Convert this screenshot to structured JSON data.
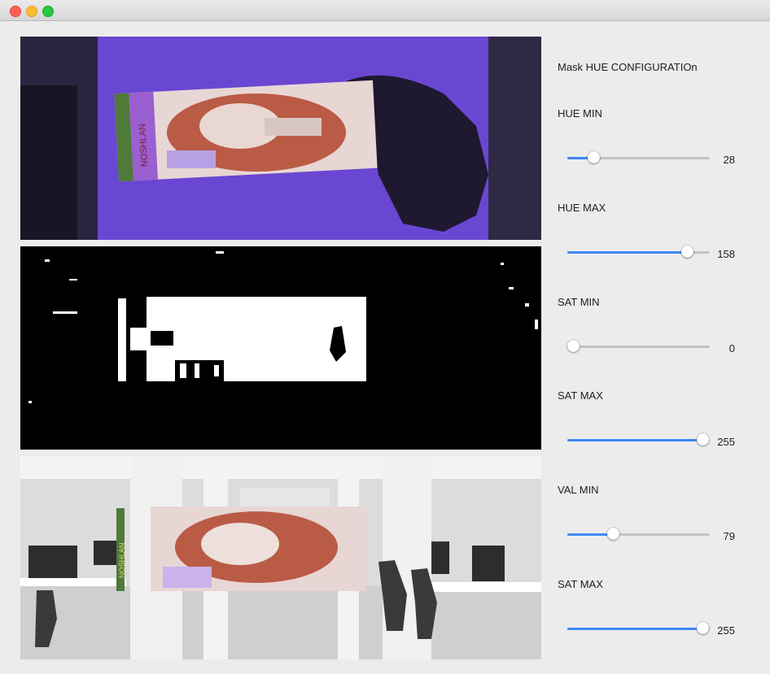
{
  "window": {
    "title": ""
  },
  "panel": {
    "title": "Mask HUE CONFIGURATIOn",
    "sliders": [
      {
        "label": "HUE MIN",
        "value": "28",
        "min": 0,
        "max": 179
      },
      {
        "label": "HUE MAX",
        "value": "158",
        "min": 0,
        "max": 179
      },
      {
        "label": "SAT MIN",
        "value": "0",
        "min": 0,
        "max": 255
      },
      {
        "label": "SAT MAX",
        "value": "255",
        "min": 0,
        "max": 255
      },
      {
        "label": "VAL MIN",
        "value": "79",
        "min": 0,
        "max": 255
      },
      {
        "label": "SAT MAX",
        "value": "255",
        "min": 0,
        "max": 255
      }
    ]
  },
  "images": {
    "camera": {
      "box_brand": "NOSHLAN"
    },
    "result": {
      "box_brand": "NOSHLAN"
    }
  },
  "colors": {
    "slider_fill": "#3f87f5",
    "slider_track": "#c4c4c4",
    "camera_background": "#6545c8",
    "window_background": "#ececec"
  }
}
